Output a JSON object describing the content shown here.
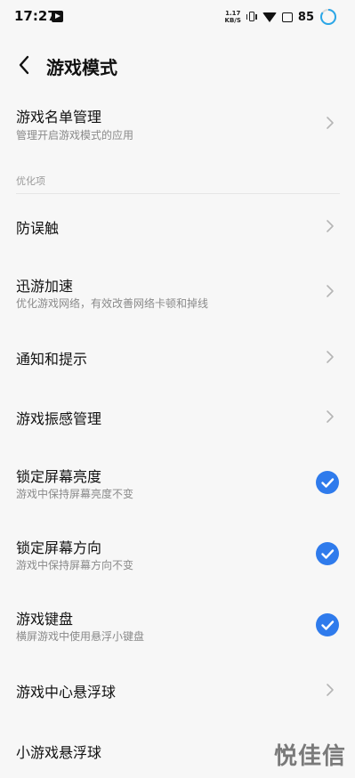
{
  "status_bar": {
    "time": "17:27",
    "net_speed_value": "1.17",
    "net_speed_unit": "KB/S",
    "battery": "85"
  },
  "header": {
    "title": "游戏模式"
  },
  "rows": {
    "game_list": {
      "title": "游戏名单管理",
      "subtitle": "管理开启游戏模式的应用"
    },
    "section_label": "优化项",
    "anti_touch": {
      "title": "防误触"
    },
    "xunyou": {
      "title": "迅游加速",
      "subtitle": "优化游戏网络，有效改善网络卡顿和掉线"
    },
    "notify": {
      "title": "通知和提示"
    },
    "vibration": {
      "title": "游戏振感管理"
    },
    "lock_brightness": {
      "title": "锁定屏幕亮度",
      "subtitle": "游戏中保持屏幕亮度不变",
      "checked": true
    },
    "lock_orientation": {
      "title": "锁定屏幕方向",
      "subtitle": "游戏中保持屏幕方向不变",
      "checked": true
    },
    "game_keyboard": {
      "title": "游戏键盘",
      "subtitle": "横屏游戏中使用悬浮小键盘",
      "checked": true
    },
    "game_center_ball": {
      "title": "游戏中心悬浮球"
    },
    "mini_game_ball": {
      "title": "小游戏悬浮球"
    }
  },
  "watermark": "悦佳信",
  "colors": {
    "accent": "#2f7bec",
    "background": "#f7f7f7",
    "subtitle": "#8a8a8a"
  }
}
